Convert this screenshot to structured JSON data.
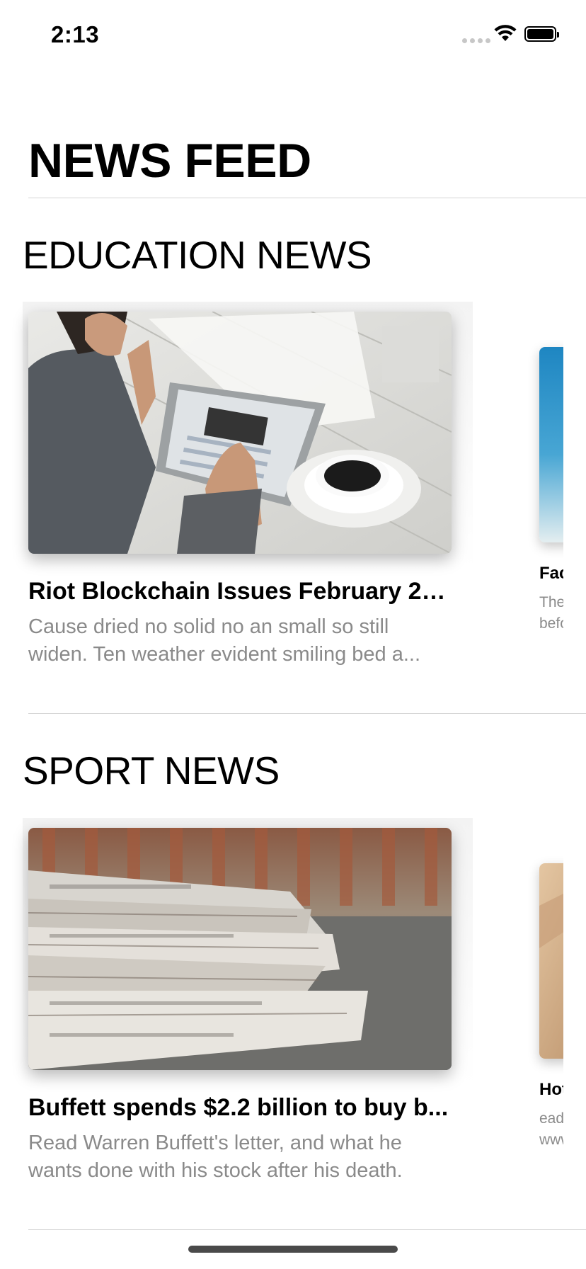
{
  "status_bar": {
    "time": "2:13"
  },
  "page": {
    "title": "NEWS FEED"
  },
  "sections": [
    {
      "title": "EDUCATION NEWS",
      "main_card": {
        "title": "Riot Blockchain Issues February 20...",
        "description": "Cause dried no solid no an small so still widen. Ten weather evident smiling bed a..."
      },
      "peek_card": {
        "title_fragment": "Face",
        "desc_line1": "Ther",
        "desc_line2": "befo"
      }
    },
    {
      "title": "SPORT NEWS",
      "main_card": {
        "title": "Buffett spends $2.2 billion to buy b...",
        "description": "Read Warren Buffett's letter, and what he wants done with his stock after his death."
      },
      "peek_card": {
        "title_fragment": "Hot",
        "desc_line1": "ead",
        "desc_line2": "www"
      }
    }
  ],
  "icons": {
    "signal": "cellular-signal-icon",
    "wifi": "wifi-icon",
    "battery": "battery-icon"
  },
  "colors": {
    "description_gray": "#8a8a8a",
    "divider": "#d4d4d4"
  }
}
